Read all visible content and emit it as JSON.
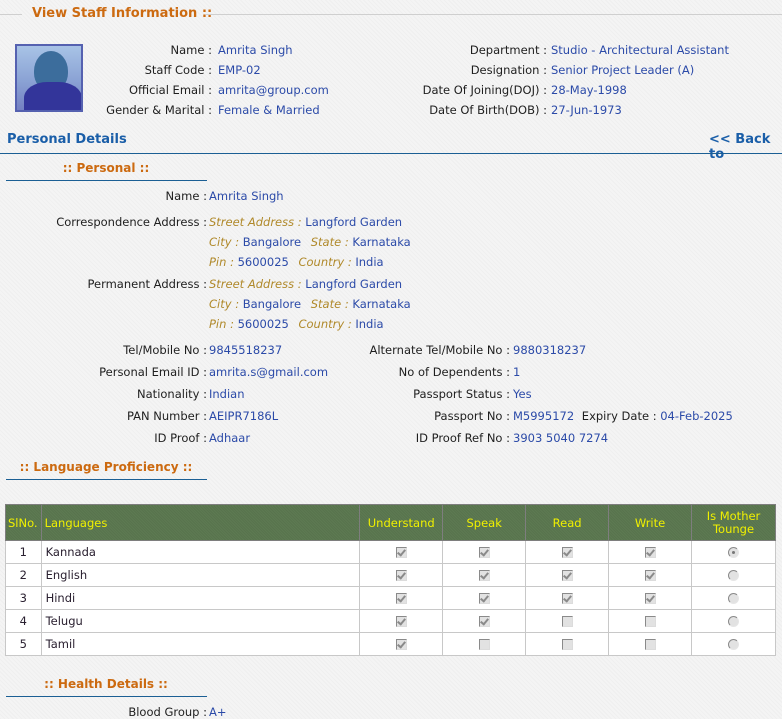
{
  "page": {
    "title": "View Staff Information ::",
    "back_link": "<< Back to",
    "personal_details_title": "Personal Details"
  },
  "summary": {
    "left": [
      {
        "label": "Name :",
        "value": "Amrita Singh"
      },
      {
        "label": "Staff Code :",
        "value": "EMP-02"
      },
      {
        "label": "Official Email :",
        "value": "amrita@group.com"
      },
      {
        "label": "Gender & Marital :",
        "value": "Female & Married"
      }
    ],
    "right": [
      {
        "label": "Department :",
        "value": "Studio - Architectural Assistant"
      },
      {
        "label": "Designation :",
        "value": "Senior Project Leader (A)"
      },
      {
        "label": "Date Of Joining(DOJ) :",
        "value": "28-May-1998"
      },
      {
        "label": "Date Of Birth(DOB) :",
        "value": "27-Jun-1973"
      }
    ]
  },
  "personal": {
    "heading": ":: Personal ::",
    "name_label": "Name :",
    "name_value": "Amrita Singh",
    "correspondence": {
      "label": "Correspondence Address :",
      "street_label": "Street Address :",
      "street": "Langford Garden",
      "city_label": "City :",
      "city": "Bangalore",
      "state_label": "State :",
      "state": "Karnataka",
      "pin_label": "Pin :",
      "pin": "5600025",
      "country_label": "Country :",
      "country": "India"
    },
    "permanent": {
      "label": "Permanent Address :",
      "street_label": "Street Address :",
      "street": "Langford Garden",
      "city_label": "City :",
      "city": "Bangalore",
      "state_label": "State :",
      "state": "Karnataka",
      "pin_label": "Pin :",
      "pin": "5600025",
      "country_label": "Country :",
      "country": "India"
    },
    "left": [
      {
        "label": "Tel/Mobile No :",
        "value": "9845518237"
      },
      {
        "label": "Personal Email ID :",
        "value": "amrita.s@gmail.com"
      },
      {
        "label": "Nationality :",
        "value": "Indian"
      },
      {
        "label": "PAN Number :",
        "value": "AEIPR7186L"
      },
      {
        "label": "ID Proof :",
        "value": "Adhaar"
      }
    ],
    "right": [
      {
        "label": "Alternate Tel/Mobile No :",
        "value": "9880318237"
      },
      {
        "label": "No of Dependents :",
        "value": "1"
      },
      {
        "label": "Passport Status :",
        "value": "Yes"
      },
      {
        "label": "Passport No :",
        "value": "M5995172"
      },
      {
        "label": "ID Proof Ref No :",
        "value": "3903 5040 7274"
      }
    ],
    "expiry_label": "Expiry Date :",
    "expiry_value": "04-Feb-2025"
  },
  "language": {
    "heading": ":: Language Proficiency ::",
    "columns": [
      "SlNo.",
      "Languages",
      "Understand",
      "Speak",
      "Read",
      "Write",
      "Is Mother Tounge"
    ],
    "rows": [
      {
        "sl": "1",
        "name": "Kannada",
        "understand": true,
        "speak": true,
        "read": true,
        "write": true,
        "mother": true
      },
      {
        "sl": "2",
        "name": "English",
        "understand": true,
        "speak": true,
        "read": true,
        "write": true,
        "mother": false
      },
      {
        "sl": "3",
        "name": "Hindi",
        "understand": true,
        "speak": true,
        "read": true,
        "write": true,
        "mother": false
      },
      {
        "sl": "4",
        "name": "Telugu",
        "understand": true,
        "speak": true,
        "read": false,
        "write": false,
        "mother": false
      },
      {
        "sl": "5",
        "name": "Tamil",
        "understand": true,
        "speak": false,
        "read": false,
        "write": false,
        "mother": false
      }
    ]
  },
  "health": {
    "heading": ":: Health Details ::",
    "blood_group_label": "Blood Group :",
    "blood_group_value": "A+"
  }
}
